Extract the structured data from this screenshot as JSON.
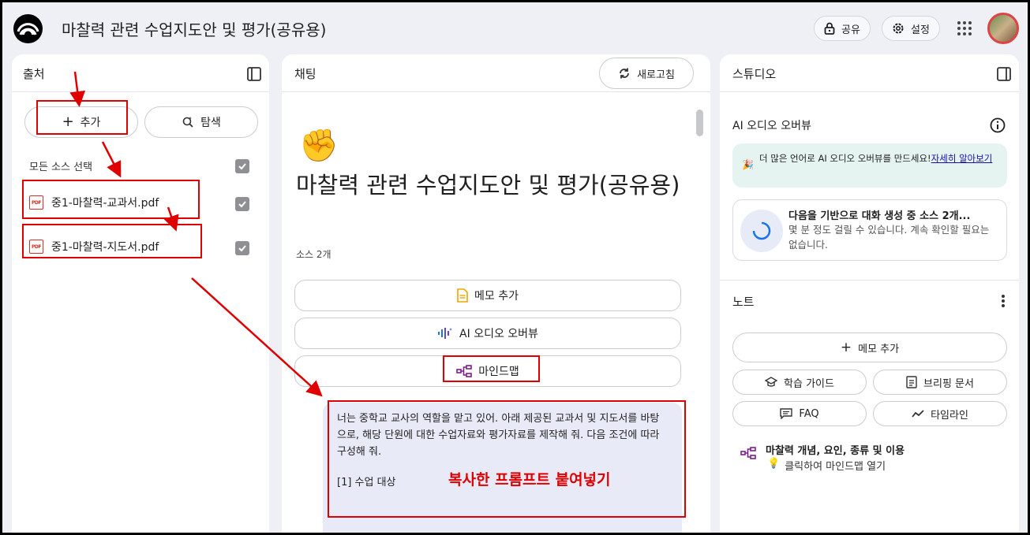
{
  "header": {
    "title": "마찰력 관련 수업지도안 및 평가(공유용)",
    "share_label": "공유",
    "settings_label": "설정"
  },
  "sources": {
    "title": "출처",
    "add_label": "추가",
    "explore_label": "탐색",
    "select_all_label": "모든 소스 선택",
    "items": [
      {
        "name": "중1-마찰력-교과서.pdf",
        "icon": "PDF"
      },
      {
        "name": "중1-마찰력-지도서.pdf",
        "icon": "PDF"
      }
    ]
  },
  "chat": {
    "title": "채팅",
    "refresh_label": "새로고침",
    "emoji": "✊",
    "notebook_title": "마찰력 관련 수업지도안 및 평가(공유용)",
    "source_count": "소스 2개",
    "actions": {
      "add_memo": "메모 추가",
      "audio_overview": "AI 오디오 오버뷰",
      "mindmap": "마인드맵"
    },
    "prompt_text": "너는 중학교 교사의 역할을 맡고 있어. 아래 제공된 교과서 및 지도서를 바탕으로, 해당 단원에 대한 수업자료와 평가자료를 제작해 줘. 다음 조건에 따라 구성해 줘.",
    "prompt_section": "[1] 수업 대상",
    "annotation": "복사한 프롬프트 붙여넣기"
  },
  "studio": {
    "title": "스튜디오",
    "audio_section_title": "AI 오디오 오버뷰",
    "banner_text": "더 많은 언어로 AI 오디오 오버뷰를 만드세요!",
    "banner_link": "자세히 알아보기",
    "generating_title": "다음을 기반으로 대화 생성 중 소스 2개...",
    "generating_sub": "몇 분 정도 걸릴 수 있습니다. 계속 확인할 필요는 없습니다.",
    "notes_title": "노트",
    "add_memo_label": "메모 추가",
    "chips": [
      "학습 가이드",
      "브리핑 문서",
      "FAQ",
      "타임라인"
    ],
    "note_item_title": "마찰력 개념, 요인, 종류 및 이용",
    "note_item_sub": "클릭하여 마인드맵 열기"
  },
  "colors": {
    "annotation_red": "#e00000",
    "mindmap_purple": "#7b1f8c",
    "pdf_red": "#d93025",
    "link_blue": "#1a0dab"
  }
}
